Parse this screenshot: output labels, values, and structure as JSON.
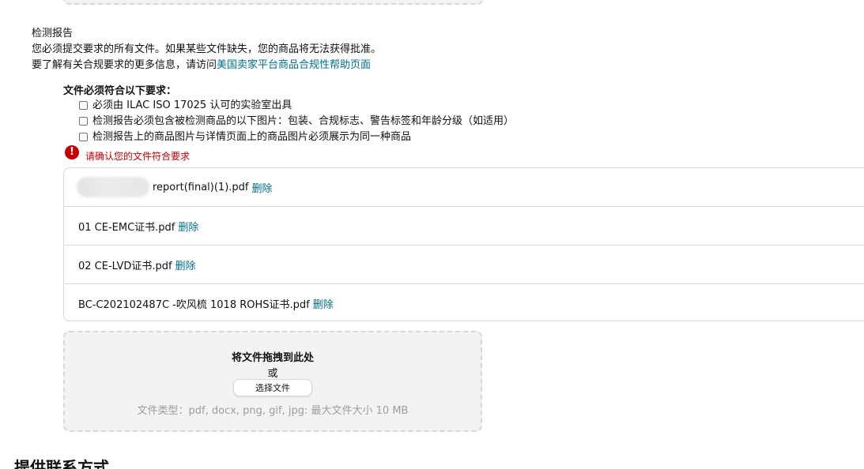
{
  "section": {
    "title": "检测报告",
    "intro_line1": "您必须提交要求的所有文件。如果某些文件缺失，您的商品将无法获得批准。",
    "intro_line2_prefix": "要了解有关合规要求的更多信息，请访问",
    "help_link": "美国卖家平台商品合规性帮助页面"
  },
  "requirements": {
    "title": "文件必须符合以下要求：",
    "items": [
      "必须由 ILAC ISO 17025 认可的实验室出具",
      "检测报告必须包含被检测商品的以下图片：包装、合规标志、警告标签和年龄分级（如适用）",
      "检测报告上的商品图片与详情页面上的商品图片必须展示为同一种商品"
    ]
  },
  "error": {
    "icon": "!",
    "message": "请确认您的文件符合要求"
  },
  "files": [
    {
      "name": "report(final)(1).pdf",
      "delete": "删除"
    },
    {
      "name": "01 CE-EMC证书.pdf",
      "delete": "删除"
    },
    {
      "name": "02 CE-LVD证书.pdf",
      "delete": "删除"
    },
    {
      "name": "BC-C202102487C -吹风梳 1018 ROHS证书.pdf",
      "delete": "删除"
    }
  ],
  "dropzone": {
    "title": "将文件拖拽到此处",
    "or": "或",
    "button": "选择文件",
    "file_types": "文件类型：pdf, docx, png, gif, jpg: 最大文件大小 10 MB"
  },
  "next_section": {
    "title": "提供联系方式"
  },
  "colors": {
    "link": "#007185",
    "error": "#c40000",
    "border": "#d5d9d9",
    "dropzone_bg": "#f3f3f3"
  }
}
